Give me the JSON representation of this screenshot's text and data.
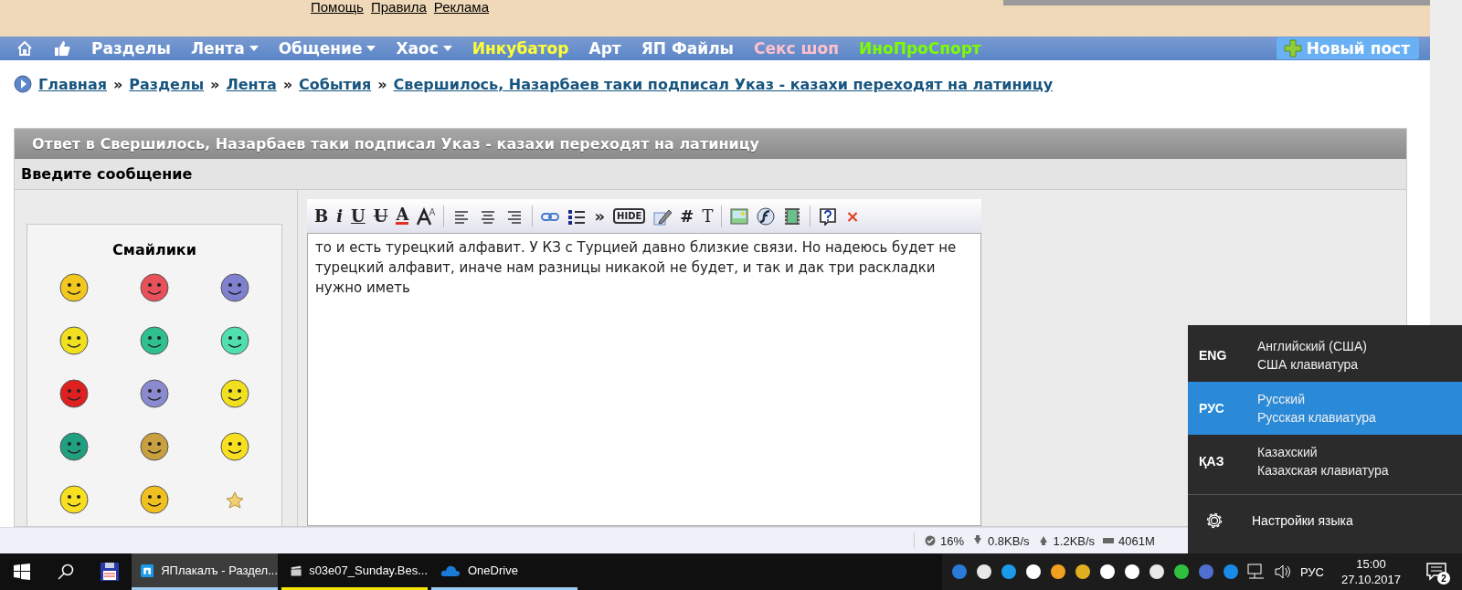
{
  "top_links": [
    "Помощь",
    "Правила",
    "Реклама"
  ],
  "nav": {
    "items": [
      {
        "label": "Разделы",
        "dropdown": false,
        "color": "#ffffff"
      },
      {
        "label": "Лента",
        "dropdown": true,
        "color": "#ffffff"
      },
      {
        "label": "Общение",
        "dropdown": true,
        "color": "#ffffff"
      },
      {
        "label": "Хаос",
        "dropdown": true,
        "color": "#ffffff"
      },
      {
        "label": "Инкубатор",
        "dropdown": false,
        "color": "#ffff33"
      },
      {
        "label": "Арт",
        "dropdown": false,
        "color": "#ffffff"
      },
      {
        "label": "ЯП Файлы",
        "dropdown": false,
        "color": "#ffffff"
      },
      {
        "label": "Секс шоп",
        "dropdown": false,
        "color": "#ffc0cb"
      },
      {
        "label": "ИноПроСпорт",
        "dropdown": false,
        "color": "#7cfc00"
      }
    ],
    "new_post": "Новый пост"
  },
  "breadcrumb": {
    "separator": "»",
    "items": [
      "Главная",
      "Разделы",
      "Лента",
      "События",
      "Свершилось, Назарбаев таки подписал Указ - казахи переходят на латиницу"
    ]
  },
  "panel": {
    "title": "Ответ в Свершилось, Назарбаев таки подписал Указ - казахи переходят на латиницу",
    "subtitle": "Введите сообщение"
  },
  "smilies": {
    "title": "Смайлики"
  },
  "toolbar": [
    {
      "kind": "bold",
      "text": "B"
    },
    {
      "kind": "italic",
      "text": "i"
    },
    {
      "kind": "underline",
      "text": "U"
    },
    {
      "kind": "strike",
      "text": "U"
    },
    {
      "kind": "textcolor",
      "text": "A"
    },
    {
      "kind": "fontsize"
    },
    {
      "kind": "separator"
    },
    {
      "kind": "alignleft"
    },
    {
      "kind": "aligncenter"
    },
    {
      "kind": "alignright"
    },
    {
      "kind": "separator"
    },
    {
      "kind": "link"
    },
    {
      "kind": "list"
    },
    {
      "kind": "quote",
      "text": "»"
    },
    {
      "kind": "bubble",
      "text": "HIDE"
    },
    {
      "kind": "pencil"
    },
    {
      "kind": "hash",
      "text": "#"
    },
    {
      "kind": "textstyle",
      "text": "T"
    },
    {
      "kind": "separator"
    },
    {
      "kind": "image"
    },
    {
      "kind": "flash"
    },
    {
      "kind": "film"
    },
    {
      "kind": "separator"
    },
    {
      "kind": "help"
    },
    {
      "kind": "close",
      "text": "×"
    }
  ],
  "message": "то и есть турецкий алфавит. У КЗ с Турцией давно близкие связи. Но надеюсь будет не турецкий алфавит, иначе нам разницы никакой не будет, и так и дак три раскладки нужно иметь",
  "status_bar": [
    "16%",
    "0.8KB/s",
    "1.2KB/s",
    "4061M"
  ],
  "language_menu": {
    "items": [
      {
        "code": "ENG",
        "name": "Английский (США)",
        "layout": "США клавиатура",
        "selected": false
      },
      {
        "code": "РУС",
        "name": "Русский",
        "layout": "Русская клавиатура",
        "selected": true
      },
      {
        "code": "ҚАЗ",
        "name": "Казахский",
        "layout": "Казахская клавиатура",
        "selected": false
      }
    ],
    "settings": "Настройки языка"
  },
  "taskbar": {
    "apps": [
      {
        "label": "ЯПлакалъ - Раздел...",
        "active": true,
        "color": "#9ecbf0"
      },
      {
        "label": "s03e07_Sunday.Bes...",
        "active": false,
        "color": "#f5e60a"
      },
      {
        "label": "OneDrive",
        "active": false,
        "color": "#9ecbf0"
      }
    ],
    "language": "РУС",
    "time": "15:00",
    "date": "27.10.2017",
    "notifications": "2"
  }
}
